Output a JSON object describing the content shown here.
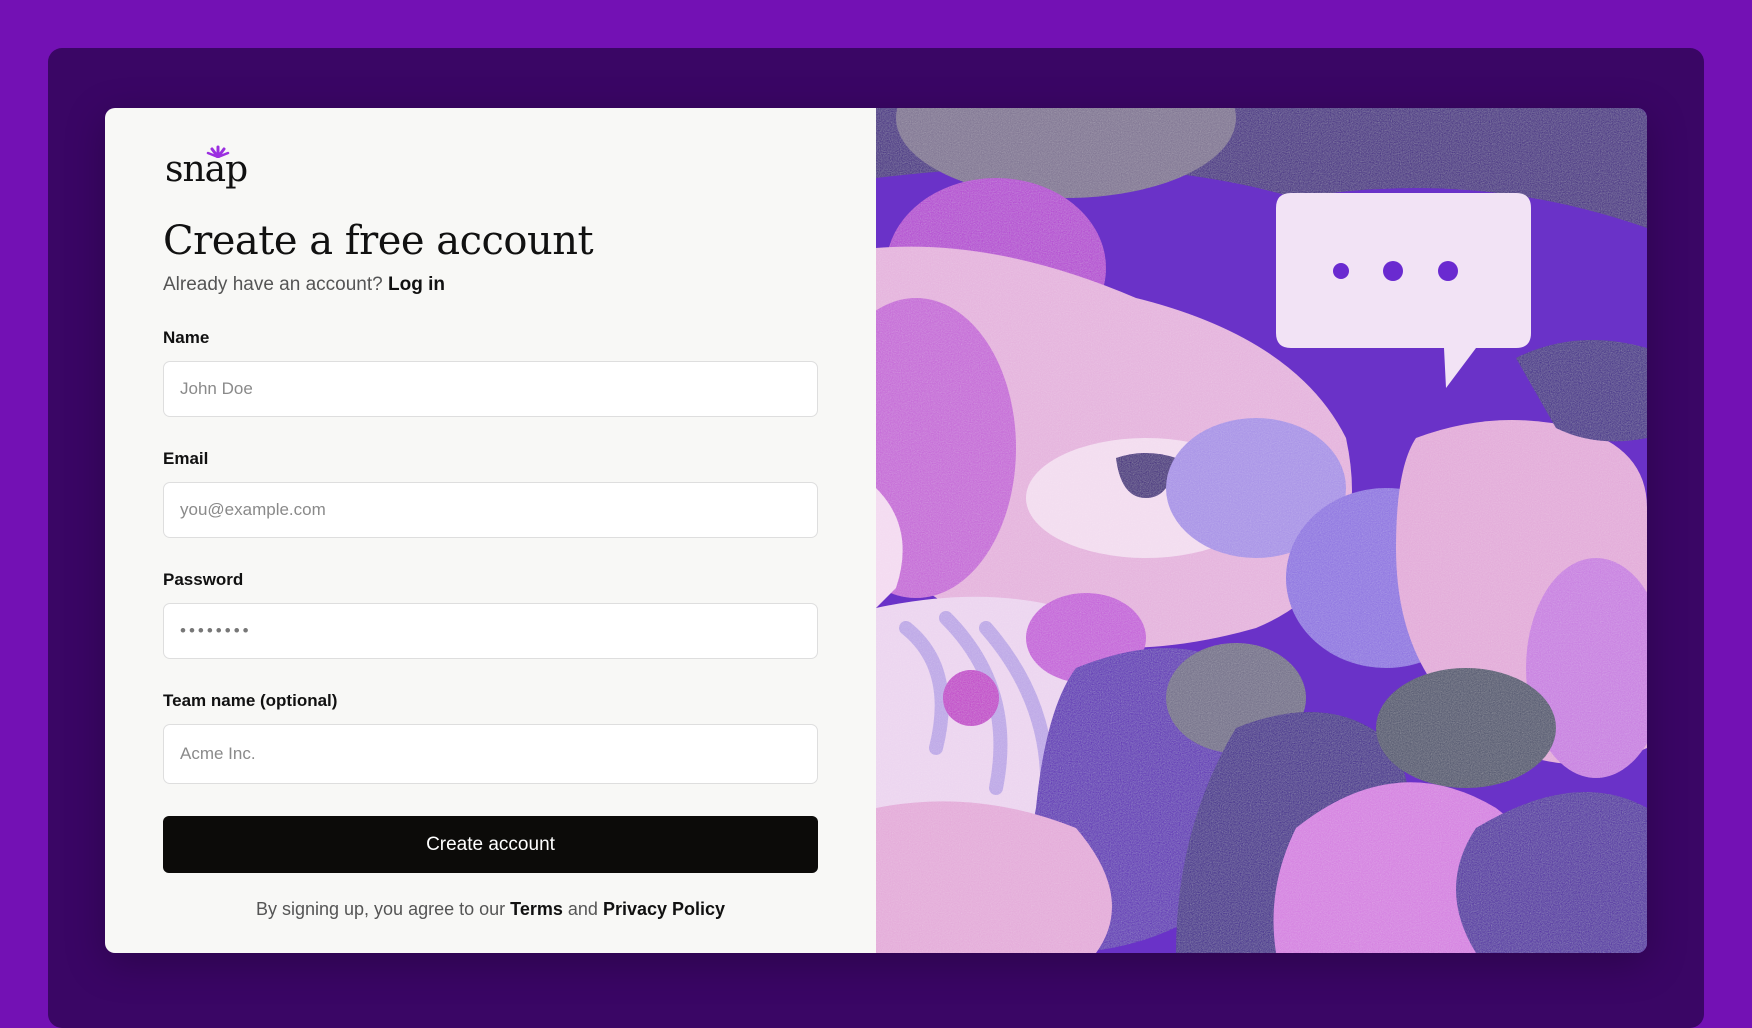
{
  "brand": {
    "logo_text": "snap",
    "accent": "#9b2fe0"
  },
  "page": {
    "background": "#7311b4",
    "frame_color": "#3a0665"
  },
  "form": {
    "title": "Create a free account",
    "subtitle_prefix": "Already have an account?",
    "login_link": "Log in",
    "name": {
      "label": "Name",
      "placeholder": "John Doe",
      "value": ""
    },
    "email": {
      "label": "Email",
      "placeholder": "you@example.com",
      "value": ""
    },
    "password": {
      "label": "Password",
      "value": "••••••••"
    },
    "team": {
      "label": "Team name (optional)",
      "placeholder": "Acme Inc.",
      "value": ""
    },
    "submit_label": "Create account",
    "terms_prefix": "By signing up, you agree to our",
    "terms_link": "Terms",
    "terms_and": "and",
    "privacy_link": "Privacy Policy"
  },
  "illustration": {
    "icon": "chat-bubble-icon"
  }
}
